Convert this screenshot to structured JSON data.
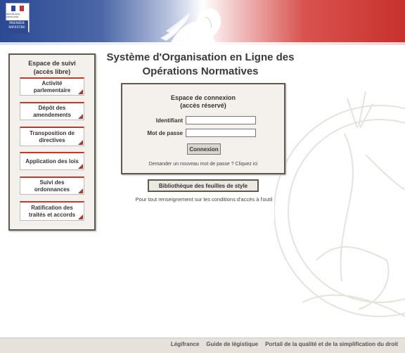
{
  "header": {
    "logo_text": "RÉPUBLIQUE FRANÇAISE",
    "logo_subtitle": "PREMIER MINISTRE",
    "colors": {
      "blue": "#2b4a93",
      "red": "#c8312d"
    }
  },
  "left_panel": {
    "title_line1": "Espace de suivi",
    "title_line2": "(accès libre)",
    "items": [
      {
        "label": "Activité parlementaire"
      },
      {
        "label": "Dépôt des amendements"
      },
      {
        "label": "Transposition de directives"
      },
      {
        "label": "Application des lois"
      },
      {
        "label": "Suivi des ordonnances"
      },
      {
        "label": "Ratification des traités et accords"
      }
    ]
  },
  "main": {
    "title_line1": "Système d'Organisation en Ligne des",
    "title_line2": "Opérations Normatives"
  },
  "login": {
    "title_line1": "Espace de connexion",
    "title_line2": "(accès réservé)",
    "username_label": "Identifiant",
    "username_value": "",
    "password_label": "Mot de passe",
    "password_value": "",
    "submit_label": "Connexion",
    "forgot_text": "Demander un nouveau mot de passe ? Cliquez ici"
  },
  "biblio_button_label": "Bibliothèque des feuilles de style",
  "info_text": "Pour tout renseignement sur les conditions d'accès à l'outil",
  "footer": {
    "links": [
      {
        "label": "Légifrance"
      },
      {
        "label": "Guide de légistique"
      },
      {
        "label": "Portail de la qualité et de la simplification du droit"
      }
    ]
  }
}
